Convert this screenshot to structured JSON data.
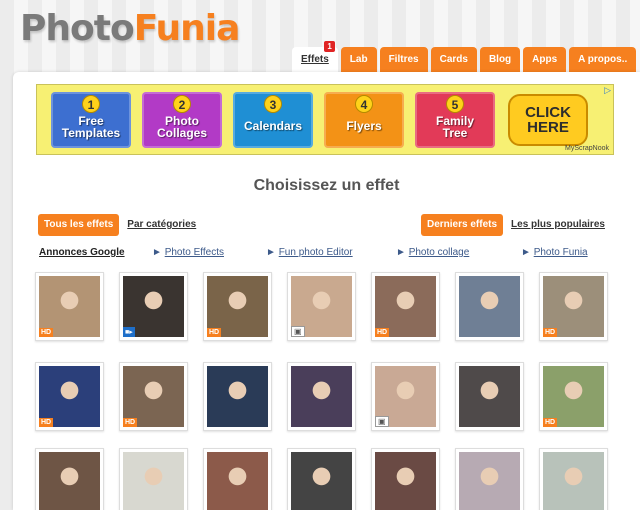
{
  "logo": {
    "part1": "Photo",
    "part2": "Funia"
  },
  "tabs": [
    {
      "label": "Effets",
      "badge": "1",
      "active": true
    },
    {
      "label": "Lab"
    },
    {
      "label": "Filtres"
    },
    {
      "label": "Cards"
    },
    {
      "label": "Blog"
    },
    {
      "label": "Apps"
    },
    {
      "label": "A propos.."
    }
  ],
  "ad": {
    "tiles": [
      {
        "num": "1",
        "l1": "Free",
        "l2": "Templates"
      },
      {
        "num": "2",
        "l1": "Photo",
        "l2": "Collages"
      },
      {
        "num": "3",
        "l1": "Calendars",
        "l2": ""
      },
      {
        "num": "4",
        "l1": "Flyers",
        "l2": ""
      },
      {
        "num": "5",
        "l1": "Family",
        "l2": "Tree"
      }
    ],
    "cta": "CLICK HERE",
    "brand": "MyScrapNook"
  },
  "heading": "Choisissez un effet",
  "filters": {
    "all": "Tous les effets",
    "by_category": "Par catégories",
    "latest": "Derniers effets",
    "popular": "Les plus populaires"
  },
  "ad_links": {
    "label": "Annonces Google",
    "items": [
      "Photo Effects",
      "Fun photo Editor",
      "Photo collage",
      "Photo Funia"
    ]
  },
  "thumb_colors": [
    "#b39474",
    "#3a3430",
    "#7a6449",
    "#c9a98f",
    "#8b6b5a",
    "#6f7f95",
    "#9c8f7a",
    "#2b3f7a",
    "#7b6552",
    "#2a3b57",
    "#4a3e5a",
    "#c9a995",
    "#4f4a4a",
    "#8ba06a",
    "#6e5545",
    "#d8d8d0",
    "#8c5a4a",
    "#444444",
    "#6a4a44",
    "#b7aab3",
    "#b8c2ba"
  ],
  "thumb_badges": [
    "hd",
    "cam",
    "hd",
    "pic",
    "hd",
    "",
    "hd",
    "hd",
    "hd",
    "",
    "",
    "pic",
    "",
    "hd",
    "",
    "",
    "",
    "",
    "",
    "",
    ""
  ]
}
